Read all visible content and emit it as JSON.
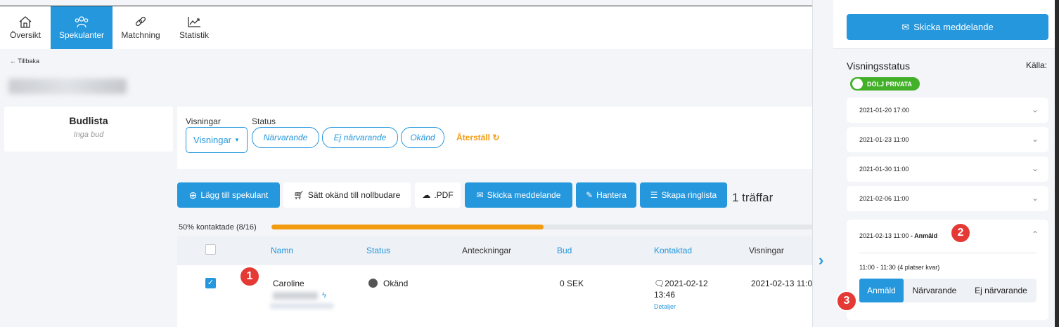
{
  "nav": {
    "items": [
      {
        "label": "Översikt",
        "icon": "home-icon"
      },
      {
        "label": "Spekulanter",
        "icon": "users-icon",
        "active": true
      },
      {
        "label": "Matchning",
        "icon": "link-icon"
      },
      {
        "label": "Statistik",
        "icon": "chart-icon"
      }
    ]
  },
  "back": {
    "label": "← Tillbaka"
  },
  "budlista": {
    "title": "Budlista",
    "subtitle": "Inga bud"
  },
  "filters": {
    "visningar_label": "Visningar",
    "status_label": "Status",
    "dropdown_value": "Visningar",
    "status_pills": [
      "Närvarande",
      "Ej närvarande",
      "Okänd"
    ],
    "reset_label": "Återställ"
  },
  "toolbar": {
    "add": "Lägg till spekulant",
    "set_unknown": "Sätt okänd till nollbudare",
    "pdf": ".PDF",
    "send": "Skicka meddelande",
    "manage": "Hantera",
    "ringlist": "Skapa ringlista",
    "hits": "1 träffar"
  },
  "progress": {
    "label": "50% kontaktade (8/16)",
    "fraction": 0.5
  },
  "table": {
    "headers": {
      "name": "Namn",
      "status": "Status",
      "notes": "Anteckningar",
      "bid": "Bud",
      "contacted": "Kontaktad",
      "viewings": "Visningar"
    },
    "row": {
      "name": "Caroline",
      "status": "Okänd",
      "bid": "0 SEK",
      "contacted_date": "2021-02-12",
      "contacted_time": "13:46",
      "details": "Detaljer",
      "viewing": "2021-02-13 11:0"
    }
  },
  "badges": [
    "1",
    "2",
    "3"
  ],
  "side": {
    "send_button": "Skicka meddelande",
    "title": "Visningsstatus",
    "source_label": "Källa:",
    "toggle_label": "DÖLJ PRIVATA",
    "viewings": [
      "2021-01-20 17:00",
      "2021-01-23 11:00",
      "2021-01-30 11:00",
      "2021-02-06 11:00"
    ],
    "open_viewing": {
      "date": "2021-02-13 11:00",
      "status": " - Anmäld",
      "slot": "11:00 - 11:30 (4 platser kvar)",
      "options": [
        "Anmäld",
        "Närvarande",
        "Ej närvarande"
      ],
      "selected": "Anmäld"
    }
  },
  "colors": {
    "accent": "#2597dd",
    "warning": "#f39c12",
    "toggle": "#43b02a",
    "badge": "#e53935"
  }
}
